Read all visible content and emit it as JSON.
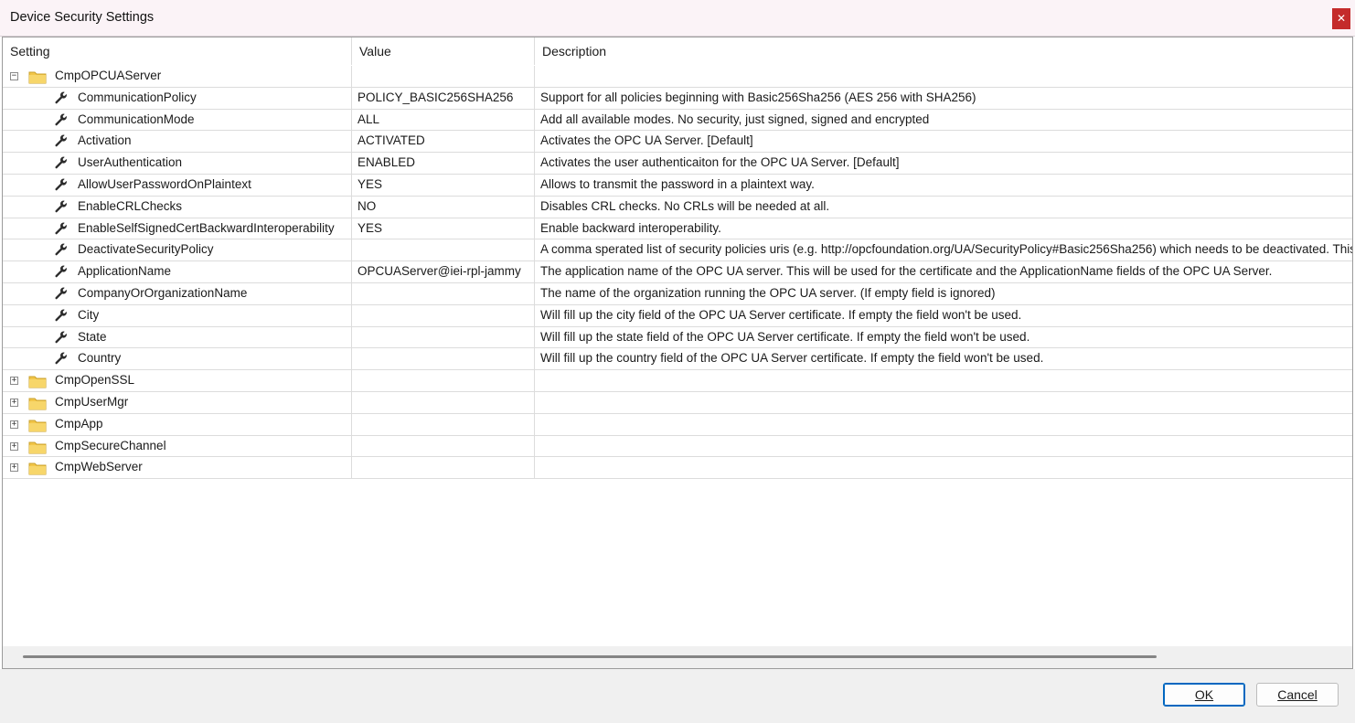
{
  "window": {
    "title": "Device Security Settings",
    "close_icon": "close-icon",
    "close_glyph": "✕"
  },
  "grid": {
    "columns": [
      "Setting",
      "Value",
      "Description"
    ],
    "rows": [
      {
        "kind": "group",
        "expander": "−",
        "name": "CmpOPCUAServer",
        "value": "",
        "description": ""
      },
      {
        "kind": "prop",
        "name": "CommunicationPolicy",
        "value": "POLICY_BASIC256SHA256",
        "description": "Support for all policies beginning with Basic256Sha256 (AES 256 with SHA256)"
      },
      {
        "kind": "prop",
        "name": "CommunicationMode",
        "value": "ALL",
        "description": "Add all available modes. No security, just signed, signed and encrypted"
      },
      {
        "kind": "prop",
        "name": "Activation",
        "value": "ACTIVATED",
        "description": "Activates the OPC UA Server. [Default]"
      },
      {
        "kind": "prop",
        "name": "UserAuthentication",
        "value": "ENABLED",
        "description": "Activates the user authenticaiton for the OPC UA Server. [Default]"
      },
      {
        "kind": "prop",
        "name": "AllowUserPasswordOnPlaintext",
        "value": "YES",
        "description": "Allows to transmit the password in a plaintext way."
      },
      {
        "kind": "prop",
        "name": "EnableCRLChecks",
        "value": "NO",
        "description": "Disables CRL checks. No CRLs will be needed at all."
      },
      {
        "kind": "prop",
        "name": "EnableSelfSignedCertBackwardInteroperability",
        "value": "YES",
        "description": "Enable backward interoperability."
      },
      {
        "kind": "prop",
        "name": "DeactivateSecurityPolicy",
        "value": "",
        "description": "A comma sperated list of security policies uris (e.g. http://opcfoundation.org/UA/SecurityPolicy#Basic256Sha256) which needs to be deactivated. This"
      },
      {
        "kind": "prop",
        "name": "ApplicationName",
        "value": "OPCUAServer@iei-rpl-jammy",
        "description": "The application name of the OPC UA server. This will be used for the certificate and the ApplicationName fields of the OPC UA Server."
      },
      {
        "kind": "prop",
        "name": "CompanyOrOrganizationName",
        "value": "",
        "description": "The name of the organization running the OPC UA server. (If empty field is ignored)"
      },
      {
        "kind": "prop",
        "name": "City",
        "value": "",
        "description": "Will fill up the city field of the OPC UA Server certificate. If empty the field won't be used."
      },
      {
        "kind": "prop",
        "name": "State",
        "value": "",
        "description": "Will fill up the state field of the OPC UA Server certificate. If empty the field won't be used."
      },
      {
        "kind": "prop",
        "name": "Country",
        "value": "",
        "description": "Will fill up the country field of the OPC UA Server certificate. If empty the field won't be used."
      },
      {
        "kind": "group",
        "expander": "+",
        "name": "CmpOpenSSL",
        "value": "",
        "description": ""
      },
      {
        "kind": "group",
        "expander": "+",
        "name": "CmpUserMgr",
        "value": "",
        "description": ""
      },
      {
        "kind": "group",
        "expander": "+",
        "name": "CmpApp",
        "value": "",
        "description": ""
      },
      {
        "kind": "group",
        "expander": "+",
        "name": "CmpSecureChannel",
        "value": "",
        "description": ""
      },
      {
        "kind": "group",
        "expander": "+",
        "name": "CmpWebServer",
        "value": "",
        "description": ""
      }
    ]
  },
  "icons": {
    "group": "folder-icon",
    "property": "wrench-icon"
  },
  "colors": {
    "folder": "#f2c649",
    "close_bg": "#c42b2b",
    "ok_border": "#0067c0"
  },
  "buttons": {
    "ok": "OK",
    "cancel": "Cancel"
  }
}
